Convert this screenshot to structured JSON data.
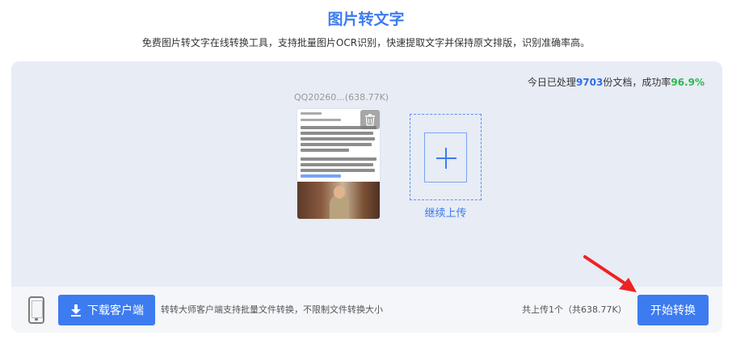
{
  "header": {
    "title": "图片转文字",
    "subtitle": "免费图片转文字在线转换工具，支持批量图片OCR识别，快速提取文字并保持原文排版，识别准确率高。"
  },
  "stats": {
    "prefix": "今日已处理",
    "count": "9703",
    "middle": "份文档，成功率",
    "rate": "96.9%"
  },
  "file": {
    "name": "QQ20260...(638.77K)"
  },
  "upload": {
    "continue_label": "继续上传"
  },
  "bottom": {
    "download_label": "下载客户端",
    "client_note": "转转大师客户端支持批量文件转换，不限制文件转换大小",
    "upload_count": "共上传1个（共638.77K）",
    "start_label": "开始转换"
  },
  "colors": {
    "accent": "#3d7bf0",
    "success": "#2db84d",
    "arrow": "#ee2222"
  }
}
